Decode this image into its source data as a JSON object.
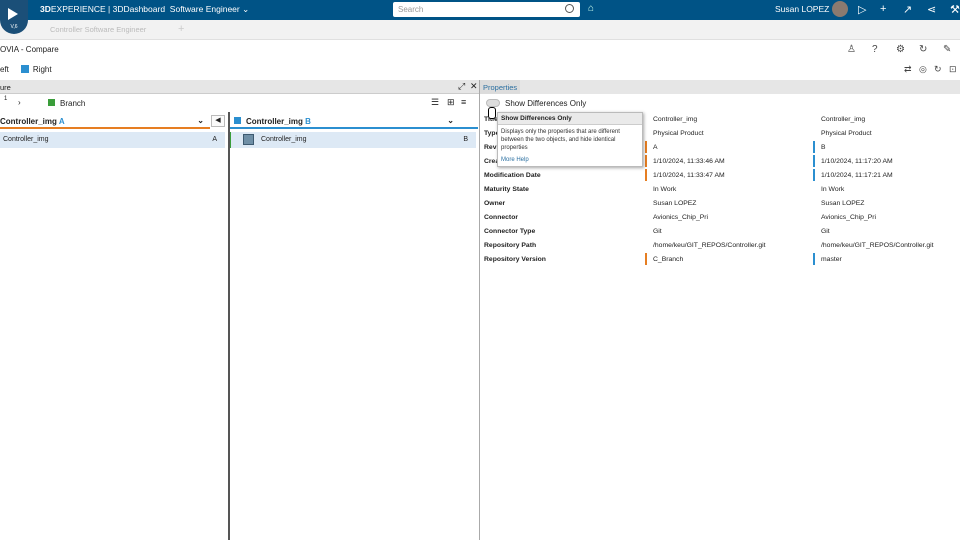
{
  "topbar": {
    "brand_main": "3D",
    "brand_rest": "EXPERIENCE | 3DDashboard",
    "role": "Software Engineer",
    "search_placeholder": "Search",
    "user_name": "Susan LOPEZ",
    "version": "V,6"
  },
  "tabstrip": {
    "tab_label": "Controller Software Engineer"
  },
  "app": {
    "title": "OVIA - Compare"
  },
  "legend": {
    "left_label": "eft",
    "right_label": "Right"
  },
  "structure": {
    "header_label": "ure",
    "level": "1",
    "branch_label": "Branch",
    "colA_title": "Controller_img",
    "colA_letter": "A",
    "colB_title": "Controller_img",
    "colB_letter": "B",
    "rowA_name": "Controller_img",
    "rowA_tag": "A",
    "rowB_name": "Controller_img",
    "rowB_tag": "B"
  },
  "properties": {
    "tab_label": "Properties",
    "toggle_label": "Show Differences Only",
    "rows": [
      {
        "key": "Title",
        "a": "Controller_img",
        "b": "Controller_img",
        "diff": false
      },
      {
        "key": "Type",
        "a": "Physical Product",
        "b": "Physical Product",
        "diff": false
      },
      {
        "key": "Revision",
        "a": "A",
        "b": "B",
        "diff": true
      },
      {
        "key": "Creation Date",
        "a": "1/10/2024, 11:33:46 AM",
        "b": "1/10/2024, 11:17:20 AM",
        "diff": true
      },
      {
        "key": "Modification Date",
        "a": "1/10/2024, 11:33:47 AM",
        "b": "1/10/2024, 11:17:21 AM",
        "diff": true
      },
      {
        "key": "Maturity State",
        "a": "In Work",
        "b": "In Work",
        "diff": false
      },
      {
        "key": "Owner",
        "a": "Susan LOPEZ",
        "b": "Susan LOPEZ",
        "diff": false
      },
      {
        "key": "Connector",
        "a": "Avionics_Chip_Pri",
        "b": "Avionics_Chip_Pri",
        "diff": false
      },
      {
        "key": "Connector Type",
        "a": "Git",
        "b": "Git",
        "diff": false
      },
      {
        "key": "Repository Path",
        "a": "/home/keu/GIT_REPOS/Controller.git",
        "b": "/home/keu/GIT_REPOS/Controller.git",
        "diff": false
      },
      {
        "key": "Repository Version",
        "a": "C_Branch",
        "b": "master",
        "diff": true
      }
    ]
  },
  "tooltip": {
    "title": "Show Differences Only",
    "body": "Displays only the properties that are different between the two objects, and hide identical properties",
    "link": "More Help"
  },
  "colors": {
    "topbar": "#005386",
    "side_a": "#e67e22",
    "side_b": "#2b8fd0"
  }
}
